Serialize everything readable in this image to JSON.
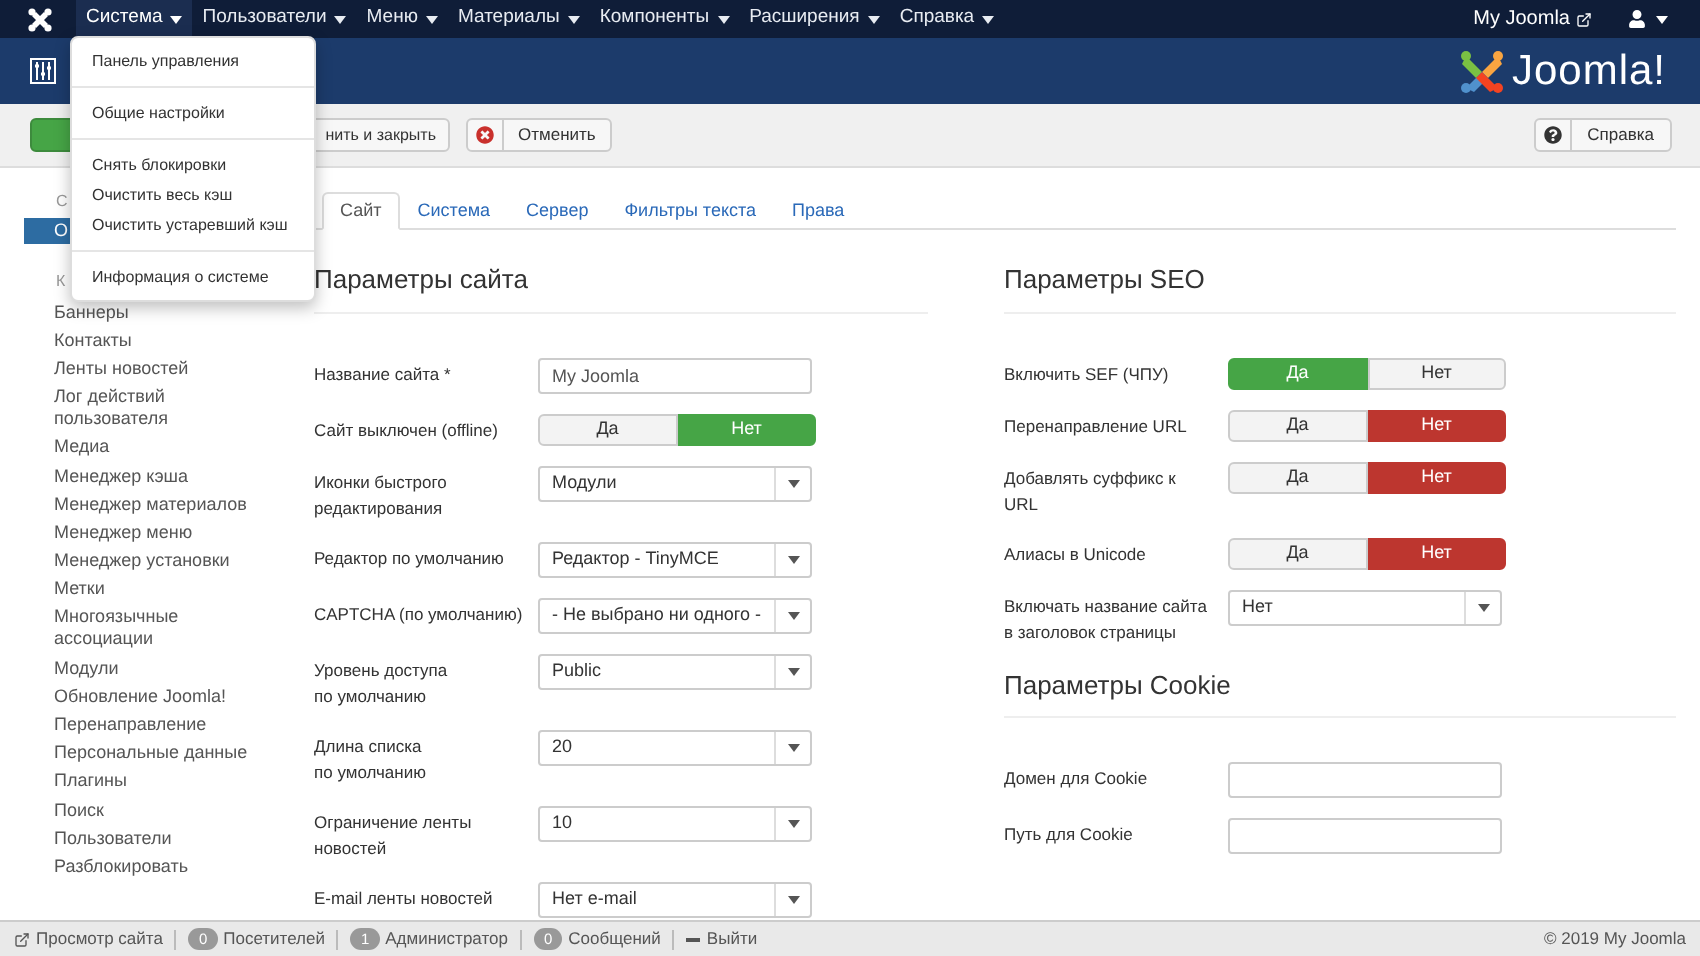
{
  "navbar": {
    "menus": [
      {
        "label": "Система",
        "open": true
      },
      {
        "label": "Пользователи",
        "open": false
      },
      {
        "label": "Меню",
        "open": false
      },
      {
        "label": "Материалы",
        "open": false
      },
      {
        "label": "Компоненты",
        "open": false
      },
      {
        "label": "Расширения",
        "open": false
      },
      {
        "label": "Справка",
        "open": false
      }
    ],
    "site_link": "My Joomla"
  },
  "header": {
    "logo_text": "Joomla!"
  },
  "dropdown": {
    "groups": [
      [
        "Панель управления"
      ],
      [
        "Общие настройки"
      ],
      [
        "Снять блокировки",
        "Очистить весь кэш",
        "Очистить устаревший кэш"
      ],
      [
        "Информация о системе"
      ]
    ]
  },
  "toolbar": {
    "buttons": [
      {
        "kind": "apply"
      },
      {
        "kind": "save_close",
        "label": "нить и закрыть"
      },
      {
        "kind": "cancel",
        "label": "Отменить"
      }
    ],
    "help": "Справка"
  },
  "sidebar": {
    "items": [
      {
        "kind": "heading",
        "label": "С"
      },
      {
        "kind": "item",
        "label": "О",
        "selected": true
      },
      {
        "kind": "heading",
        "label": "К"
      },
      {
        "kind": "item",
        "label": "Баннеры",
        "selected": false
      },
      {
        "kind": "item",
        "label": "Контакты",
        "selected": false
      },
      {
        "kind": "item",
        "label": "Ленты новостей",
        "selected": false
      },
      {
        "kind": "item",
        "label": "Лог действий пользователя",
        "selected": false
      },
      {
        "kind": "item",
        "label": "Медиа",
        "selected": false
      },
      {
        "kind": "item",
        "label": "Менеджер кэша",
        "selected": false
      },
      {
        "kind": "item",
        "label": "Менеджер материалов",
        "selected": false
      },
      {
        "kind": "item",
        "label": "Менеджер меню",
        "selected": false
      },
      {
        "kind": "item",
        "label": "Менеджер установки",
        "selected": false
      },
      {
        "kind": "item",
        "label": "Метки",
        "selected": false
      },
      {
        "kind": "item",
        "label": "Многоязычные ассоциации",
        "selected": false
      },
      {
        "kind": "item",
        "label": "Модули",
        "selected": false
      },
      {
        "kind": "item",
        "label": "Обновление Joomla!",
        "selected": false
      },
      {
        "kind": "item",
        "label": "Перенаправление",
        "selected": false
      },
      {
        "kind": "item",
        "label": "Персональные данные",
        "selected": false
      },
      {
        "kind": "item",
        "label": "Плагины",
        "selected": false
      },
      {
        "kind": "item",
        "label": "Поиск",
        "selected": false
      },
      {
        "kind": "item",
        "label": "Пользователи",
        "selected": false
      },
      {
        "kind": "item",
        "label": "Разблокировать",
        "selected": false
      }
    ]
  },
  "tabs": [
    {
      "label": "Сайт",
      "selected": true
    },
    {
      "label": "Система",
      "selected": false
    },
    {
      "label": "Сервер",
      "selected": false
    },
    {
      "label": "Фильтры текста",
      "selected": false
    },
    {
      "label": "Права",
      "selected": false
    }
  ],
  "columns": [
    [
      {
        "title": "Параметры сайта",
        "fields": [
          {
            "kind": "text",
            "label": "Название сайта *",
            "value": "My Joomla"
          },
          {
            "kind": "toggle",
            "label": "Сайт выключен (offline)",
            "options": [
              {
                "label": "Да",
                "selected": false
              },
              {
                "label": "Нет",
                "selected": true,
                "color": "#46a546"
              }
            ]
          },
          {
            "kind": "select",
            "label": "Иконки быстрого\nредактирования",
            "value": "Модули"
          },
          {
            "kind": "select",
            "label": "Редактор по умолчанию",
            "value": "Редактор - TinyMCE"
          },
          {
            "kind": "select",
            "label": "CAPTCHA (по умолчанию)",
            "value": "- Не выбрано ни одного -"
          },
          {
            "kind": "select",
            "label": "Уровень доступа\nпо умолчанию",
            "value": "Public"
          },
          {
            "kind": "select",
            "label": "Длина списка\nпо умолчанию",
            "value": "20"
          },
          {
            "kind": "select",
            "label": "Ограничение ленты\nновостей",
            "value": "10"
          },
          {
            "kind": "select",
            "label": "E-mail ленты новостей",
            "value": "Нет e-mail"
          }
        ]
      }
    ],
    [
      {
        "title": "Параметры SEO",
        "fields": [
          {
            "kind": "toggle",
            "label": "Включить SEF (ЧПУ)",
            "options": [
              {
                "label": "Да",
                "selected": true,
                "color": "#46a546"
              },
              {
                "label": "Нет",
                "selected": false
              }
            ]
          },
          {
            "kind": "toggle",
            "label": "Перенаправление URL",
            "options": [
              {
                "label": "Да",
                "selected": false
              },
              {
                "label": "Нет",
                "selected": true,
                "color": "#bd362f"
              }
            ]
          },
          {
            "kind": "toggle",
            "label": "Добавлять суффикс к\nURL",
            "options": [
              {
                "label": "Да",
                "selected": false
              },
              {
                "label": "Нет",
                "selected": true,
                "color": "#bd362f"
              }
            ]
          },
          {
            "kind": "toggle",
            "label": "Алиасы в Unicode",
            "options": [
              {
                "label": "Да",
                "selected": false
              },
              {
                "label": "Нет",
                "selected": true,
                "color": "#bd362f"
              }
            ]
          },
          {
            "kind": "select",
            "label": "Включать название сайта\nв заголовок страницы",
            "value": "Нет"
          }
        ]
      },
      {
        "title": "Параметры Cookie",
        "fields": [
          {
            "kind": "text",
            "label": "Домен для Cookie"
          },
          {
            "kind": "text",
            "label": "Путь для Cookie"
          }
        ]
      }
    ]
  ],
  "status_bar": {
    "items": [
      {
        "kind": "link",
        "label": "Просмотр сайта"
      },
      {
        "kind": "count",
        "count": "0",
        "label": "Посетителей"
      },
      {
        "kind": "count",
        "count": "1",
        "label": "Администратор"
      },
      {
        "kind": "count",
        "count": "0",
        "label": "Сообщений"
      },
      {
        "kind": "logout",
        "label": "Выйти"
      }
    ],
    "copyright": "© 2019 My Joomla"
  }
}
